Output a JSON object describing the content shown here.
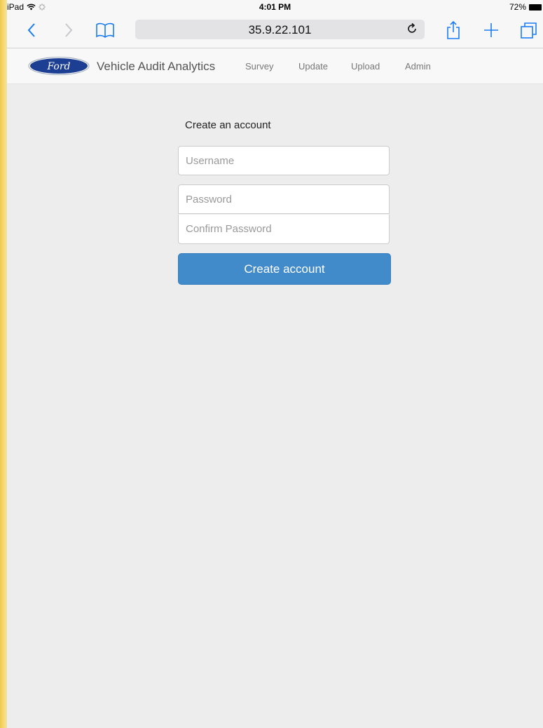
{
  "status_bar": {
    "device": "iPad",
    "time": "4:01 PM",
    "battery": "72%",
    "icons": [
      "wifi-icon",
      "activity-spinner-icon",
      "battery-icon"
    ]
  },
  "browser": {
    "address": "35.9.22.101",
    "icons": [
      "back-icon",
      "forward-icon",
      "bookmarks-icon",
      "reload-icon",
      "share-icon",
      "new-tab-icon",
      "tabs-icon"
    ]
  },
  "navbar": {
    "brand": "Vehicle Audit Analytics",
    "logo_text": "Ford",
    "links": [
      "Survey",
      "Update",
      "Upload",
      "Admin"
    ]
  },
  "form": {
    "title": "Create an account",
    "username_placeholder": "Username",
    "password_placeholder": "Password",
    "confirm_placeholder": "Confirm Password",
    "submit_label": "Create account"
  },
  "colors": {
    "accent": "#1a7cf5",
    "button": "#428bca",
    "ford_blue": "#1c3f94",
    "page_bg": "#ededed"
  }
}
